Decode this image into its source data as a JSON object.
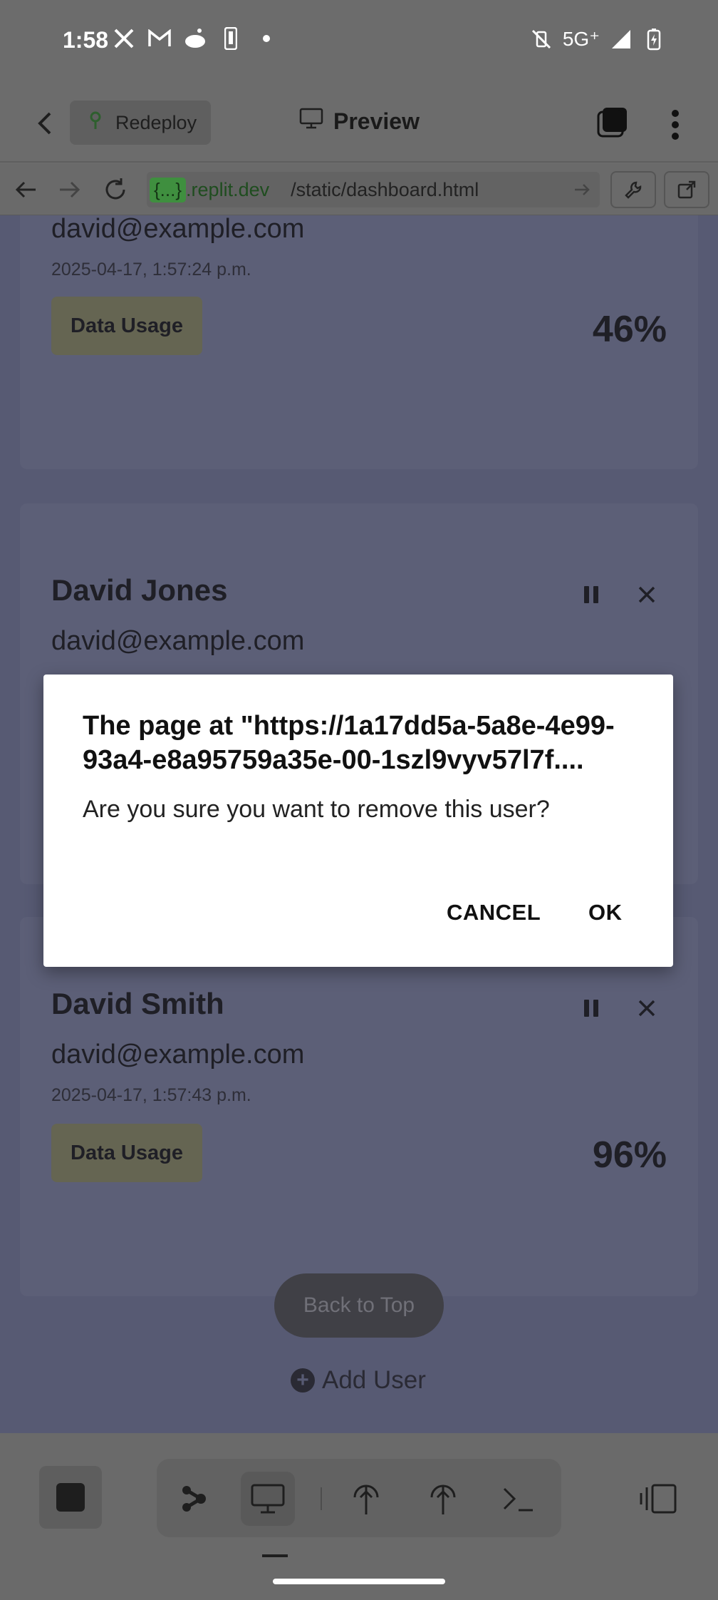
{
  "status_bar": {
    "time": "1:58",
    "network": "5G⁺"
  },
  "header": {
    "redeploy_label": "Redeploy",
    "preview_label": "Preview"
  },
  "url_bar": {
    "domain_tag": "{...}",
    "domain": ".replit.dev",
    "path": "/static/dashboard.html"
  },
  "cards": [
    {
      "email": "david@example.com",
      "timestamp": "2025-04-17, 1:57:24 p.m.",
      "usage_label": "Data Usage",
      "usage_value": "46%"
    },
    {
      "name": "David Jones",
      "email": "david@example.com"
    },
    {
      "name": "David Smith",
      "email": "david@example.com",
      "timestamp": "2025-04-17, 1:57:43 p.m.",
      "usage_label": "Data Usage",
      "usage_value": "96%"
    }
  ],
  "page_actions": {
    "back_to_top": "Back to Top",
    "add_user": "Add User"
  },
  "dialog": {
    "title": "The page at \"https://1a17dd5a-5a8e-4e99-93a4-e8a95759a35e-00-1szl9vyv57l7f....",
    "message": "Are you sure you want to remove this user?",
    "cancel_label": "CANCEL",
    "ok_label": "OK"
  },
  "colors": {
    "scrim_content": "#575a73",
    "dialog_bg": "#ffffff",
    "url_domain_tag": "#3f8f3f"
  }
}
